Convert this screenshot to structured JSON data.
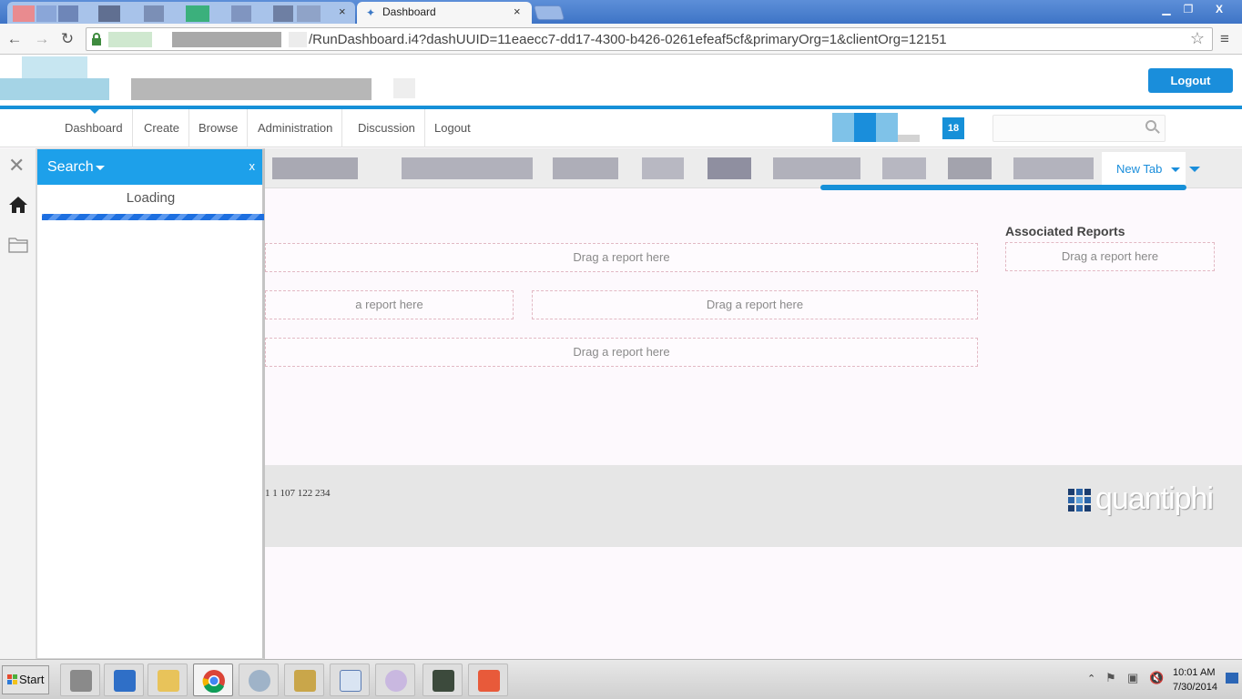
{
  "browser": {
    "active_tab_title": "Dashboard",
    "url": "/RunDashboard.i4?dashUUID=11eaecc7-dd17-4300-b426-0261efeaf5cf&primaryOrg=1&clientOrg=12151",
    "close_glyph": "×"
  },
  "header": {
    "logout_label": "Logout",
    "accent_color": "#1690d8"
  },
  "nav": {
    "items": [
      {
        "label": "Dashboard"
      },
      {
        "label": "Create"
      },
      {
        "label": "Browse"
      },
      {
        "label": "Administration"
      },
      {
        "label": "Discussion"
      },
      {
        "label": "Logout"
      }
    ],
    "badge_count": "18",
    "search_icon": "search-icon"
  },
  "search_panel": {
    "title": "Search",
    "close_label": "x",
    "loading_text": "Loading"
  },
  "dashboard": {
    "new_tab_label": "New Tab",
    "drop_placeholder": "Drag a report here",
    "partial_drop_placeholder": "a report here",
    "associated_reports_title": "Associated Reports",
    "footer_text": "1 1 107 122 234",
    "brand_name": "quantiphi"
  },
  "taskbar": {
    "start_label": "Start",
    "time": "10:01 AM",
    "date": "7/30/2014"
  }
}
